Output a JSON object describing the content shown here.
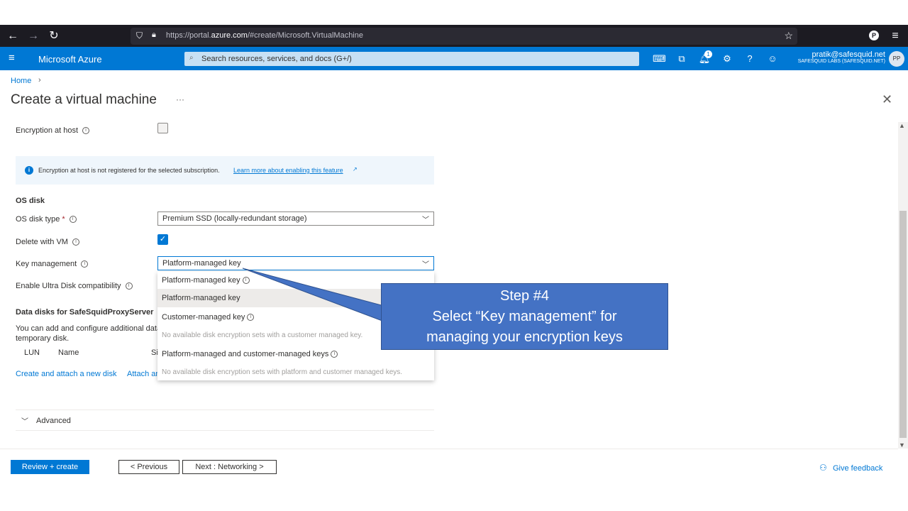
{
  "browser": {
    "url_prefix": "https://portal.",
    "url_domain": "azure.com",
    "url_path": "/#create/Microsoft.VirtualMachine"
  },
  "header": {
    "brand": "Microsoft Azure",
    "search_placeholder": "Search resources, services, and docs (G+/)",
    "notification_count": "1",
    "user_email": "pratik@safesquid.net",
    "user_org": "SAFESQUID LABS (SAFESQUID.NET)",
    "user_initials": "PP"
  },
  "breadcrumb": {
    "home": "Home"
  },
  "page": {
    "title": "Create a virtual machine",
    "more": "···"
  },
  "form": {
    "encryption_at_host_label": "Encryption at host",
    "info_banner_text": "Encryption at host is not registered for the selected subscription.",
    "info_banner_link": "Learn more about enabling this feature",
    "os_disk_heading": "OS disk",
    "os_disk_type_label": "OS disk type",
    "required_mark": "*",
    "os_disk_type_value": "Premium SSD (locally-redundant storage)",
    "delete_with_vm_label": "Delete with VM",
    "key_management_label": "Key management",
    "key_management_value": "Platform-managed key",
    "ultra_disk_label": "Enable Ultra Disk compatibility",
    "data_disks_heading": "Data disks for SafeSquidProxyServer",
    "data_disks_desc_1": "You can add and configure additional data",
    "data_disks_desc_2": "temporary disk.",
    "col_lun": "LUN",
    "col_name": "Name",
    "col_size": "Si",
    "create_attach_link": "Create and attach a new disk",
    "attach_existing_link": "Attach an",
    "advanced_label": "Advanced"
  },
  "dropdown": {
    "options": [
      {
        "label": "Platform-managed key"
      },
      {
        "label": "Platform-managed key"
      },
      {
        "label": "Customer-managed key"
      },
      {
        "label": "No available disk encryption sets with a customer managed key."
      },
      {
        "label": "Platform-managed and customer-managed keys"
      },
      {
        "label": "No available disk encryption sets with platform and customer managed keys."
      }
    ]
  },
  "callout": {
    "line1": "Step #4",
    "line2": "Select “Key management”  for",
    "line3": "managing your encryption keys"
  },
  "footer": {
    "review_create": "Review + create",
    "previous": "< Previous",
    "next": "Next : Networking >",
    "feedback": "Give feedback"
  },
  "colors": {
    "accent": "#0078d4",
    "callout": "#4472c4"
  }
}
